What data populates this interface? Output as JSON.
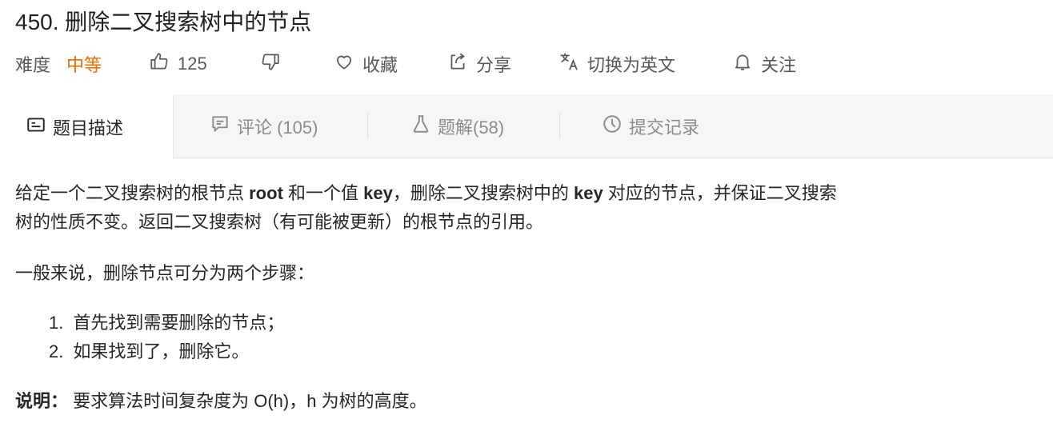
{
  "problem": {
    "title": "450. 删除二叉搜索树中的节点"
  },
  "meta": {
    "difficulty_label": "难度",
    "difficulty_value": "中等",
    "likes": "125",
    "favorite_label": "收藏",
    "share_label": "分享",
    "translate_label": "切换为英文",
    "follow_label": "关注"
  },
  "tabs": {
    "description": "题目描述",
    "comments": "评论 (105)",
    "solutions": "题解(58)",
    "submissions": "提交记录"
  },
  "description": {
    "line1_a": "给定一个二叉搜索树的根节点 ",
    "line1_root": "root",
    "line1_b": " 和一个值 ",
    "line1_key": "key",
    "line1_c": "，删除二叉搜索树中的 ",
    "line1_key2": "key",
    "line1_d": " 对应的节点，并保证二叉搜索",
    "line2": "树的性质不变。返回二叉搜索树（有可能被更新）的根节点的引用。",
    "para2": "一般来说，删除节点可分为两个步骤：",
    "steps": [
      {
        "num": "1.",
        "text": "首先找到需要删除的节点；"
      },
      {
        "num": "2.",
        "text": "如果找到了，删除它。"
      }
    ],
    "note_label": "说明：",
    "note_text": " 要求算法时间复杂度为 O(h)，h 为树的高度。"
  },
  "colors": {
    "difficulty_medium": "#ef6c00",
    "tab_bar_bg": "#f6f6f6",
    "muted_text": "#8c8c8c"
  }
}
